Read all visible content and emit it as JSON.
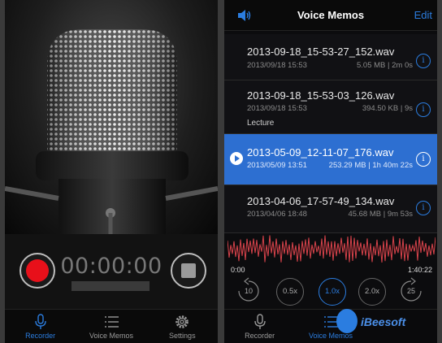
{
  "recorder": {
    "timer": "00:00:00",
    "tabs": [
      {
        "label": "Recorder",
        "icon": "microphone-icon"
      },
      {
        "label": "Voice Memos",
        "icon": "list-icon"
      },
      {
        "label": "Settings",
        "icon": "gear-icon"
      }
    ]
  },
  "memos_screen": {
    "title": "Voice Memos",
    "edit": "Edit",
    "memos": [
      {
        "name": "2013-09-18_15-53-27_152.wav",
        "date": "2013/09/18 15:53",
        "meta": "5.05 MB | 2m 0s"
      },
      {
        "name": "2013-09-18_15-53-03_126.wav",
        "date": "2013/09/18 15:53",
        "meta": "394.50 KB | 9s",
        "label": "Lecture"
      },
      {
        "name": "2013-05-09_12-11-07_176.wav",
        "date": "2013/05/09 13:51",
        "meta": "253.29 MB | 1h 40m 22s",
        "selected": true
      },
      {
        "name": "2013-04-06_17-57-49_134.wav",
        "date": "2013/04/06 18:48",
        "meta": "45.68 MB | 9m 53s"
      }
    ],
    "time_start": "0:00",
    "time_end": "1:40:22",
    "skip_back": "10",
    "skip_fwd": "25",
    "speeds": [
      "0.5x",
      "1.0x",
      "2.0x"
    ],
    "active_speed": "1.0x",
    "tabs": [
      {
        "label": "Recorder",
        "icon": "microphone-icon"
      },
      {
        "label": "Voice Memos",
        "icon": "list-icon"
      }
    ]
  },
  "watermark": "iBeesoft",
  "colors": {
    "accent": "#2b7de0",
    "record": "#e8101a",
    "waveform": "#d9434b",
    "selected_row": "#2d6fd1"
  }
}
